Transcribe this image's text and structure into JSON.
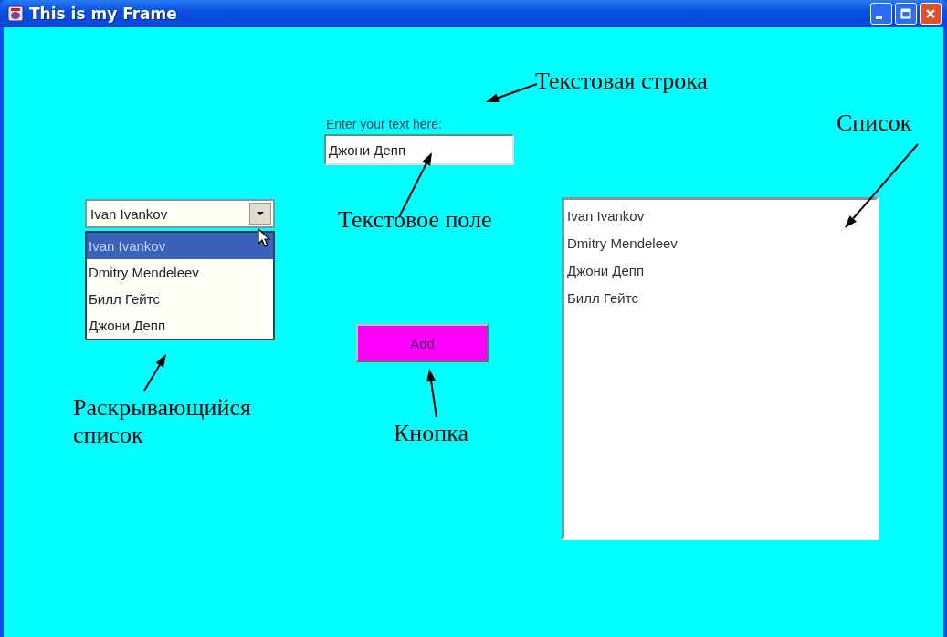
{
  "window": {
    "title": "This is my Frame"
  },
  "text_prompt": "Enter your text here:",
  "text_field": {
    "value": "Джони Депп"
  },
  "combo_box": {
    "value": "Ivan Ivankov",
    "expanded": true,
    "options": [
      {
        "label": "Ivan Ivankov",
        "selected": true
      },
      {
        "label": "Dmitry Mendeleev",
        "selected": false
      },
      {
        "label": "Билл Гейтс",
        "selected": false
      },
      {
        "label": "Джони Депп",
        "selected": false
      }
    ]
  },
  "add_button": {
    "label": "Add"
  },
  "list": {
    "items": [
      {
        "label": "Ivan Ivankov",
        "selected": false
      },
      {
        "label": "Dmitry Mendeleev",
        "selected": false
      },
      {
        "label": "Джони Депп",
        "selected": false
      },
      {
        "label": "Билл Гейтс",
        "selected": false
      }
    ]
  },
  "annotations": [
    {
      "text": "Текстовая строка"
    },
    {
      "text": "Список"
    },
    {
      "text": "Текстовое поле"
    },
    {
      "text": "Раскрывающийся список"
    },
    {
      "text": "Кнопка"
    }
  ]
}
